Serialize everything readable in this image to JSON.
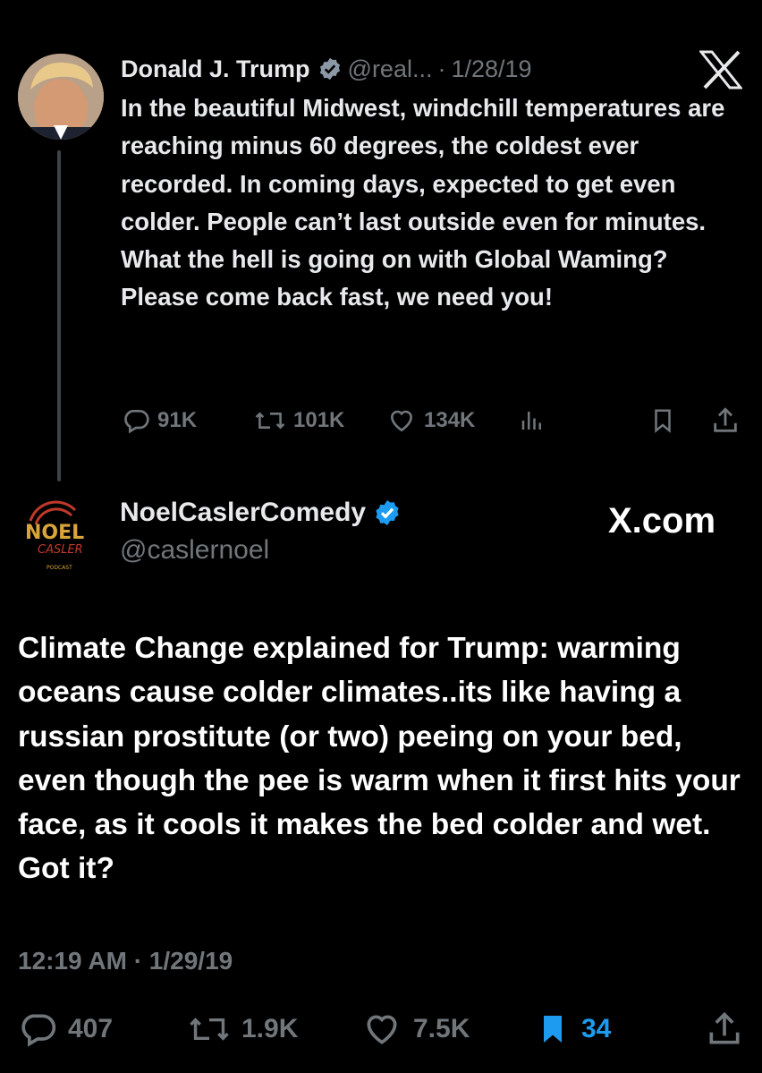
{
  "tweet1": {
    "name": "Donald J. Trump",
    "handle": "@real...",
    "separator": "·",
    "date": "1/28/19",
    "text": "In the beautiful Midwest, windchill temperatures are reaching minus 60 degrees, the coldest ever recorded. In coming days, expected to get even colder. People can’t last outside even for minutes. What the hell is going on with Global Waming? Please come back fast, we need you!",
    "stats": {
      "replies": "91K",
      "reposts": "101K",
      "likes": "134K"
    }
  },
  "tweet2": {
    "name": "NoelCaslerComedy",
    "handle": "@caslernoel",
    "watermark": "X.com",
    "logo_text": {
      "top": "NOEL",
      "bottom": "CASLER",
      "sub": "PODCAST"
    },
    "text": "Climate Change explained for Trump: warming oceans cause colder climates..its like having a russian prostitute (or two) peeing on your bed, even though the pee is warm when it first hits your face, as it cools it makes the bed colder and wet. Got it?",
    "time": "12:19 AM",
    "separator": "·",
    "date": "1/29/19",
    "stats": {
      "replies": "407",
      "reposts": "1.9K",
      "likes": "7.5K",
      "bookmarks": "34"
    }
  },
  "colors": {
    "background": "#000000",
    "text": "#e7e9ea",
    "muted": "#71767b",
    "accent": "#1d9bf0"
  },
  "icons": [
    "verified-badge-icon",
    "x-logo-icon",
    "reply-icon",
    "repost-icon",
    "like-icon",
    "views-icon",
    "bookmark-icon",
    "share-icon"
  ]
}
